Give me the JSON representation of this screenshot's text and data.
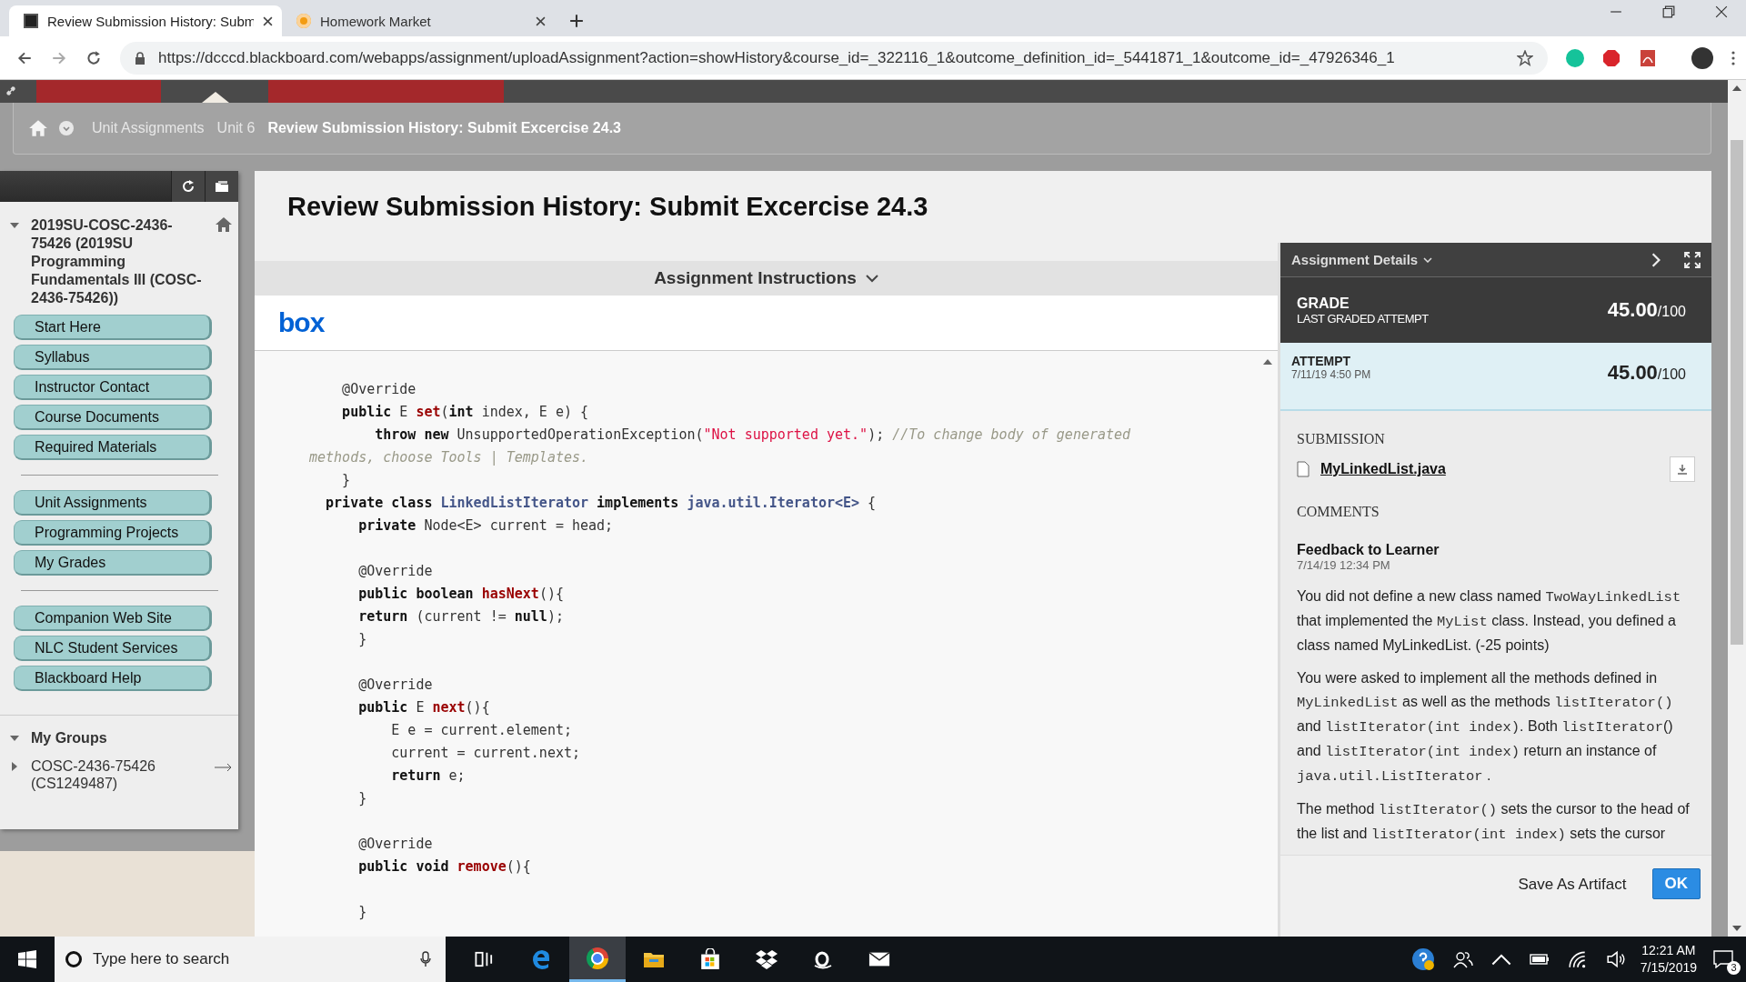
{
  "browser": {
    "tabs": [
      {
        "title": "Review Submission History: Subm",
        "kind": "blackboard",
        "selected": true
      },
      {
        "title": "Homework Market",
        "kind": "market",
        "selected": false
      }
    ],
    "url": "https://dcccd.blackboard.com/webapps/assignment/uploadAssignment?action=showHistory&course_id=_322116_1&outcome_definition_id=_5441871_1&outcome_id=_47926346_1"
  },
  "breadcrumb": [
    {
      "label": "Unit Assignments",
      "current": false
    },
    {
      "label": "Unit 6",
      "current": false
    },
    {
      "label": "Review Submission History: Submit Excercise 24.3",
      "current": true
    }
  ],
  "sidebar": {
    "course_title": "2019SU-COSC-2436-75426 (2019SU Programming Fundamentals III (COSC-2436-75426))",
    "course_expanded": true,
    "menu_groups": [
      [
        "Start Here",
        "Syllabus",
        "Instructor Contact",
        "Course Documents",
        "Required Materials"
      ],
      [
        "Unit Assignments",
        "Programming Projects",
        "My Grades"
      ],
      [
        "Companion Web Site",
        "NLC Student Services",
        "Blackboard Help"
      ]
    ],
    "groups_heading": "My Groups",
    "groups_expanded": true,
    "groups": [
      {
        "label": "COSC-2436-75426 (CS1249487)",
        "expanded": false
      }
    ]
  },
  "page_title": "Review Submission History: Submit Excercise 24.3",
  "instructions": {
    "label": "Assignment Instructions",
    "logo_text": "box",
    "code_lines": [
      {
        "kind": "code",
        "tokens": [
          {
            "kind": "plain",
            "text": "    @Override"
          }
        ]
      },
      {
        "kind": "code",
        "tokens": [
          {
            "kind": "kw",
            "text": "    public"
          },
          {
            "kind": "plain",
            "text": " E "
          },
          {
            "kind": "fn",
            "text": "set"
          },
          {
            "kind": "plain",
            "text": "("
          },
          {
            "kind": "kw",
            "text": "int"
          },
          {
            "kind": "plain",
            "text": " index, E e) {"
          }
        ]
      },
      {
        "kind": "code",
        "tokens": [
          {
            "kind": "kw",
            "text": "        throw new"
          },
          {
            "kind": "plain",
            "text": " UnsupportedOperationException("
          },
          {
            "kind": "str",
            "text": "\"Not supported yet.\""
          },
          {
            "kind": "plain",
            "text": "); "
          },
          {
            "kind": "cmt",
            "text": "//To change body of generated"
          }
        ]
      },
      {
        "kind": "code",
        "tokens": [
          {
            "kind": "cmt",
            "text": "methods, choose Tools | Templates."
          }
        ]
      },
      {
        "kind": "code",
        "tokens": [
          {
            "kind": "plain",
            "text": "    }"
          }
        ]
      },
      {
        "kind": "code",
        "tokens": [
          {
            "kind": "kw",
            "text": "  private class "
          },
          {
            "kind": "type",
            "text": "LinkedListIterator"
          },
          {
            "kind": "kw",
            "text": " implements "
          },
          {
            "kind": "type",
            "text": "java.util.Iterator<E>"
          },
          {
            "kind": "plain",
            "text": " {"
          }
        ]
      },
      {
        "kind": "code",
        "tokens": [
          {
            "kind": "kw",
            "text": "      private"
          },
          {
            "kind": "plain",
            "text": " Node<E> current = head;"
          }
        ]
      },
      {
        "kind": "blank"
      },
      {
        "kind": "code",
        "tokens": [
          {
            "kind": "plain",
            "text": "      @Override"
          }
        ]
      },
      {
        "kind": "code",
        "tokens": [
          {
            "kind": "kw",
            "text": "      public boolean "
          },
          {
            "kind": "fn",
            "text": "hasNext"
          },
          {
            "kind": "plain",
            "text": "(){"
          }
        ]
      },
      {
        "kind": "code",
        "tokens": [
          {
            "kind": "kw",
            "text": "      return"
          },
          {
            "kind": "plain",
            "text": " (current != "
          },
          {
            "kind": "kw",
            "text": "null"
          },
          {
            "kind": "plain",
            "text": ");"
          }
        ]
      },
      {
        "kind": "code",
        "tokens": [
          {
            "kind": "plain",
            "text": "      }"
          }
        ]
      },
      {
        "kind": "blank"
      },
      {
        "kind": "code",
        "tokens": [
          {
            "kind": "plain",
            "text": "      @Override"
          }
        ]
      },
      {
        "kind": "code",
        "tokens": [
          {
            "kind": "kw",
            "text": "      public"
          },
          {
            "kind": "plain",
            "text": " E "
          },
          {
            "kind": "fn",
            "text": "next"
          },
          {
            "kind": "plain",
            "text": "(){"
          }
        ]
      },
      {
        "kind": "code",
        "tokens": [
          {
            "kind": "plain",
            "text": "          E e = current.element;"
          }
        ]
      },
      {
        "kind": "code",
        "tokens": [
          {
            "kind": "plain",
            "text": "          current = current.next;"
          }
        ]
      },
      {
        "kind": "code",
        "tokens": [
          {
            "kind": "kw",
            "text": "          return"
          },
          {
            "kind": "plain",
            "text": " e;"
          }
        ]
      },
      {
        "kind": "code",
        "tokens": [
          {
            "kind": "plain",
            "text": "      }"
          }
        ]
      },
      {
        "kind": "blank"
      },
      {
        "kind": "code",
        "tokens": [
          {
            "kind": "plain",
            "text": "      @Override"
          }
        ]
      },
      {
        "kind": "code",
        "tokens": [
          {
            "kind": "kw",
            "text": "      public void "
          },
          {
            "kind": "fn",
            "text": "remove"
          },
          {
            "kind": "plain",
            "text": "(){"
          }
        ]
      },
      {
        "kind": "blank"
      },
      {
        "kind": "code",
        "tokens": [
          {
            "kind": "plain",
            "text": "      }"
          }
        ]
      }
    ]
  },
  "details": {
    "header": "Assignment Details",
    "grade": {
      "label": "GRADE",
      "sublabel": "LAST GRADED ATTEMPT",
      "score": "45.00",
      "total": "/100"
    },
    "attempt": {
      "label": "ATTEMPT",
      "date": "7/11/19 4:50 PM",
      "score": "45.00",
      "total": "/100"
    },
    "submission_label": "SUBMISSION",
    "file": "MyLinkedList.java",
    "comments_label": "COMMENTS",
    "feedback_title": "Feedback to Learner",
    "feedback_date": "7/14/19 12:34 PM",
    "paragraphs": [
      [
        {
          "kind": "text",
          "text": "You did not define a new class named "
        },
        {
          "kind": "code",
          "text": "TwoWayLinkedList"
        },
        {
          "kind": "text",
          "text": " that implemented the "
        },
        {
          "kind": "code",
          "text": "MyList"
        },
        {
          "kind": "text",
          "text": " class. Instead, you defined a class named MyLinkedList. (-25 points)"
        }
      ],
      [
        {
          "kind": "text",
          "text": "You were asked to implement all the methods defined in "
        },
        {
          "kind": "code",
          "text": "MyLinkedList"
        },
        {
          "kind": "text",
          "text": " as well as the methods "
        },
        {
          "kind": "code",
          "text": "listIterator()"
        },
        {
          "kind": "text",
          "text": " and "
        },
        {
          "kind": "code",
          "text": "listIterator(int index)"
        },
        {
          "kind": "text",
          "text": ". Both "
        },
        {
          "kind": "code",
          "text": "listIterator"
        },
        {
          "kind": "text",
          "text": "() and "
        },
        {
          "kind": "code",
          "text": "listIterator(int index)"
        },
        {
          "kind": "text",
          "text": " return an instance of "
        },
        {
          "kind": "code",
          "text": "java.util.ListIterator"
        },
        {
          "kind": "text",
          "text": " ."
        }
      ],
      [
        {
          "kind": "text",
          "text": "The method "
        },
        {
          "kind": "code",
          "text": "listIterator()"
        },
        {
          "kind": "text",
          "text": " sets the cursor to the head of the list and "
        },
        {
          "kind": "code",
          "text": "listIterator(int index)"
        },
        {
          "kind": "text",
          "text": " sets the cursor"
        }
      ]
    ],
    "buttons": [
      {
        "label": "Save As Artifact",
        "kind": "link"
      },
      {
        "label": "OK",
        "kind": "primary"
      }
    ]
  },
  "taskbar": {
    "search_placeholder": "Type here to search",
    "apps": [
      {
        "kind": "taskview",
        "selected": false
      },
      {
        "kind": "edge",
        "selected": false
      },
      {
        "kind": "chrome",
        "selected": true
      },
      {
        "kind": "explorer",
        "selected": false
      },
      {
        "kind": "store",
        "selected": false
      },
      {
        "kind": "dropbox",
        "selected": false
      },
      {
        "kind": "amazon",
        "selected": false
      },
      {
        "kind": "mail",
        "selected": false
      }
    ],
    "time": "12:21 AM",
    "date": "7/15/2019",
    "notification_count": "3"
  }
}
